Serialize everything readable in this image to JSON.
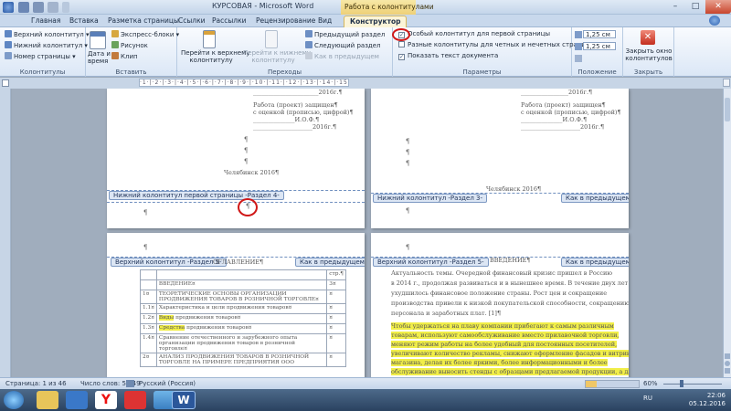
{
  "titlebar": {
    "app_title": "КУРСОВАЯ - Microsoft Word",
    "context_title": "Работа с колонтитулами",
    "minimize": "–",
    "maximize": "□",
    "close": "✕"
  },
  "tabs": [
    "Главная",
    "Вставка",
    "Разметка страницы",
    "Ссылки",
    "Рассылки",
    "Рецензирование",
    "Вид",
    "Конструктор"
  ],
  "ribbon": {
    "group_hf": {
      "label": "Колонтитулы",
      "header": "Верхний колонтитул",
      "footer": "Нижний колонтитул",
      "page_number": "Номер страницы"
    },
    "group_insert": {
      "label": "Вставить",
      "datetime_line1": "Дата и",
      "datetime_line2": "время",
      "quick_parts": "Экспресс-блоки",
      "picture": "Рисунок",
      "clip": "Клип"
    },
    "group_nav": {
      "label": "Переходы",
      "goto_header_1": "Перейти к верхнему",
      "goto_header_2": "колонтитулу",
      "goto_footer_1": "Перейти к нижнему",
      "goto_footer_2": "колонтитулу",
      "prev_section": "Предыдущий раздел",
      "next_section": "Следующий раздел",
      "link_prev": "Как в предыдущем"
    },
    "group_params": {
      "label": "Параметры",
      "diff_first": "Особый колонтитул для первой страницы",
      "diff_odd_even": "Разные колонтитулы для четных и нечетных страниц",
      "show_text": "Показать текст документа"
    },
    "group_position": {
      "label": "Положение",
      "header_dist": "1,25 см",
      "footer_dist": "1,25 см"
    },
    "group_close": {
      "label": "Закрыть",
      "close_1": "Закрыть окно",
      "close_2": "колонтитулов"
    }
  },
  "ruler": {
    "marks": "·1·|·2·|·3·|·4·|·5·|·6·|·7·|·8·|·9·|·10·|·11·|·12·|·13·|·14·|·15·|·16·|·17·"
  },
  "pages": {
    "p1": {
      "year_line": "______________________2016г.¶",
      "work": "Работа (проект) защищен¶",
      "grade": "с оценкой (прописью, цифрой)¶",
      "fio": "______________И.О.Ф.¶",
      "date": "____________________2016г.¶",
      "city": "Челябинск 2016¶",
      "footer_tag": "Нижний колонтитул первой страницы -Раздел 4-",
      "para": "¶"
    },
    "p2": {
      "year_line": "________________2016г.¶",
      "work": "Работа (проект) защищен¶",
      "grade": "с оценкой (прописью, цифрой)¶",
      "fio": "______________И.О.Ф.¶",
      "date": "____________________2016г.¶",
      "city": "Челябинск 2016¶",
      "footer_tag": "Нижний колонтитул -Раздел 3-",
      "same_as_prev": "Как в предыдущем",
      "para": "¶"
    },
    "p3": {
      "header_tag": "Верхний колонтитул -Раздел 5-",
      "same_as_prev": "Как в предыдущем",
      "toc_title": "ОГЛАВЛЕНИЕ¶",
      "toc": [
        {
          "num": "",
          "text": "",
          "page": "стр.¶"
        },
        {
          "num": "",
          "text": "ВВЕДЕНИЕ¤",
          "page": "3¤"
        },
        {
          "num": "1¤",
          "text": "ТЕОРЕТИЧЕСКИЕ ОСНОВЫ ОРГАНИЗАЦИИ ПРОДВИЖЕНИЯ ТОВАРОВ В РОЗНИЧНОЙ ТОРГОВЛЕ¤",
          "page": "¤"
        },
        {
          "num": "1.1¤",
          "text": "Характеристика и цели продвижения товаров¤",
          "page": "¤"
        },
        {
          "num": "1.2¤",
          "text": "Виды продвижения товаров¤",
          "page": "¤"
        },
        {
          "num": "1.3¤",
          "text": "Средства продвижения товаров¤",
          "page": "¤"
        },
        {
          "num": "1.4¤",
          "text": "Сравнение отечественного и зарубежного опыта организации продвижения товаров в розничной торговле¤",
          "page": "¤"
        },
        {
          "num": "2¤",
          "text": "АНАЛИЗ ПРОДВИЖЕНИЯ ТОВАРОВ В РОЗНИЧНОЙ ТОРГОВЛЕ НА ПРИМЕРЕ ПРЕДПРИЯТИЯ ООО",
          "page": "¤"
        }
      ]
    },
    "p4": {
      "header_tag": "Верхний колонтитул -Раздел 5-",
      "same_as_prev": "Как в предыдущем",
      "intro_title": "ВВЕДЕНИЕ¶",
      "lines": [
        "Актуальность темы. Очередной финансовый кризис пришел в Россию",
        "в 2014 г., продолжая развиваться и в нынешнее время. В течение двух лет",
        "ухудшилось финансовое положение страны. Рост цен и сокращение",
        "производства привели к низкой покупательской способности, сокращению",
        "персонала и заработных плат. [1]¶"
      ],
      "hl_lines": [
        "Чтобы удержаться на плаву компании прибегают к самым различным",
        "товарам, используют самообслуживание вместо прилавочной торговли,",
        "меняют режим работы на более удобный для постоянных посетителей,",
        "увеличивают количество рекламы, снижают оформление фасадов и витрин",
        "магазина, делая их более яркими, более информационными и более",
        "обслуживание выносить стенды с образцами предлагаемой продукции, а для"
      ]
    }
  },
  "status": {
    "page": "Страница: 1 из 46",
    "words": "Число слов: 5 249",
    "lang": "Русский (Россия)",
    "zoom": "60%"
  },
  "tray": {
    "lang": "RU",
    "time": "22:06",
    "date": "05.12.2016"
  }
}
